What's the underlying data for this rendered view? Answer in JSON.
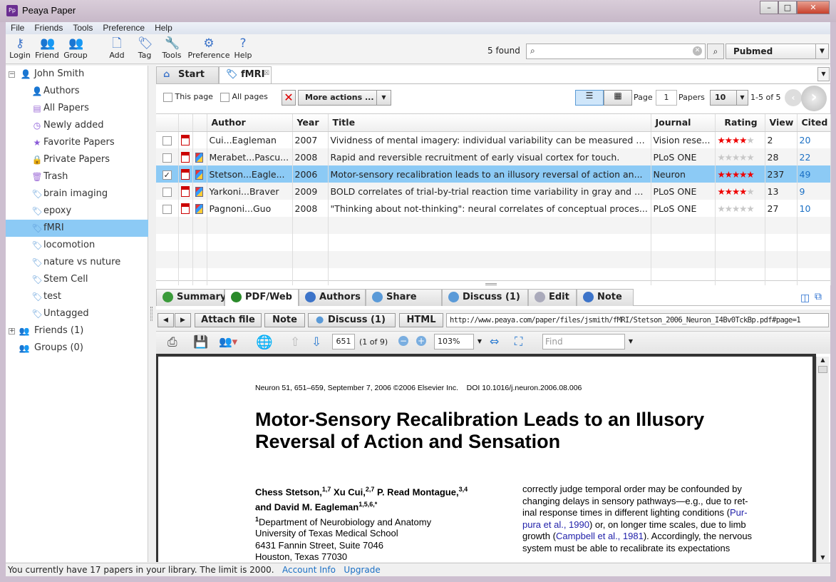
{
  "window": {
    "title": "Peaya Paper",
    "app_icon": "Pp",
    "minimize": "–",
    "maximize": "□",
    "close": "✕"
  },
  "menu": [
    "File",
    "Friends",
    "Tools",
    "Preference",
    "Help"
  ],
  "toolbar": [
    {
      "label": "Login",
      "icon": "key-icon"
    },
    {
      "label": "Friend",
      "icon": "friends-icon"
    },
    {
      "label": "Group",
      "icon": "group-icon"
    },
    {
      "label": "Add",
      "icon": "add-document-icon"
    },
    {
      "label": "Tag",
      "icon": "tag-icon"
    },
    {
      "label": "Tools",
      "icon": "wrench-icon"
    },
    {
      "label": "Preference",
      "icon": "gear-icon"
    },
    {
      "label": "Help",
      "icon": "help-icon"
    }
  ],
  "search": {
    "found": "5 found",
    "value": "",
    "database": "Pubmed"
  },
  "sidebar": {
    "user": "John Smith",
    "items": [
      "Authors",
      "All Papers",
      "Newly added",
      "Favorite Papers",
      "Private Papers",
      "Trash",
      "brain imaging",
      "epoxy",
      "fMRI",
      "locomotion",
      "nature vs nuture",
      "Stem Cell",
      "test",
      "Untagged"
    ],
    "selected": "fMRI",
    "friends": "Friends (1)",
    "groups": "Groups (0)"
  },
  "tabs": [
    "Start",
    "fMRI"
  ],
  "actions": {
    "this_page": "This page",
    "all_pages": "All pages",
    "more_actions": "More actions ...",
    "page_label": "Page",
    "page": "1",
    "papers_label": "Papers",
    "papers_per_page": "10",
    "range": "1-5 of 5"
  },
  "table": {
    "columns": [
      "Author",
      "Year",
      "Title",
      "Journal",
      "Rating",
      "View",
      "Cited"
    ],
    "rows": [
      {
        "checked": false,
        "has_doc": false,
        "author": "Cui...Eagleman",
        "year": "2007",
        "title": "Vividness of mental imagery: individual variability can be measured o...",
        "journal": "Vision rese...",
        "rating": 4,
        "view": "2",
        "cited": "20"
      },
      {
        "checked": false,
        "has_doc": true,
        "author": "Merabet...Pascu...",
        "year": "2008",
        "title": "Rapid and reversible recruitment of early visual cortex for touch.",
        "journal": "PLoS ONE",
        "rating": 0,
        "view": "28",
        "cited": "22"
      },
      {
        "checked": true,
        "has_doc": true,
        "author": "Stetson...Eagle...",
        "year": "2006",
        "title": "Motor-sensory recalibration leads to an illusory reversal of action an...",
        "journal": "Neuron",
        "rating": 5,
        "view": "237",
        "cited": "49"
      },
      {
        "checked": false,
        "has_doc": true,
        "author": "Yarkoni...Braver",
        "year": "2009",
        "title": "BOLD correlates of trial-by-trial reaction time variability in gray and w...",
        "journal": "PLoS ONE",
        "rating": 4,
        "view": "13",
        "cited": "9"
      },
      {
        "checked": false,
        "has_doc": true,
        "author": "Pagnoni...Guo",
        "year": "2008",
        "title": "\"Thinking about not-thinking\": neural correlates of conceptual proces...",
        "journal": "PLoS ONE",
        "rating": 0,
        "view": "27",
        "cited": "10"
      }
    ]
  },
  "detail_tabs": [
    "Summary",
    "PDF/Web",
    "Authors",
    "Share",
    "Discuss (1)",
    "Edit",
    "Note"
  ],
  "detail_active": "PDF/Web",
  "pdfbar": {
    "attach": "Attach file",
    "note": "Note",
    "discuss": "Discuss (1)",
    "html": "HTML",
    "url": "http://www.peaya.com/paper/files/jsmith/fMRI/Stetson_2006_Neuron_I4Bv0TckBp.pdf#page=1"
  },
  "viewer": {
    "page": "651",
    "of": "(1 of 9)",
    "zoom": "103%",
    "find_placeholder": "Find"
  },
  "paper": {
    "header": "Neuron 51, 651–659, September 7, 2006 ©2006 Elsevier Inc.    DOI 10.1016/j.neuron.2006.08.006",
    "title1": "Motor-Sensory Recalibration Leads to an Illusory",
    "title2": "Reversal of Action and Sensation",
    "a1": "Chess Stetson,",
    "s1": "1,7",
    "a2": " Xu Cui,",
    "s2": "2,7",
    "a3": " P. Read Montague,",
    "s3": "3,4",
    "a4": "and David M. Eagleman",
    "s4": "1,5,6,*",
    "aff_sup": "1",
    "aff1": "Department of Neurobiology and Anatomy",
    "aff2": "University of Texas Medical School",
    "aff3": "6431 Fannin Street, Suite 7046",
    "aff4": "Houston, Texas 77030",
    "r1": "correctly judge temporal order may be confounded by",
    "r2": "changing delays in sensory pathways—e.g., due to ret-",
    "r3a": "inal response times in different lighting conditions (",
    "r3b": "Pur-",
    "r4a": "pura et al., 1990",
    "r4b": ") or, on longer time scales, due to limb",
    "r5a": "growth (",
    "r5b": "Campbell et al., 1981",
    "r5c": "). Accordingly, the nervous",
    "r6": "system must be able to recalibrate its expectations"
  },
  "status": {
    "text": "You currently have 17 papers in your library. The limit is 2000.",
    "account": "Account Info",
    "upgrade": "Upgrade"
  }
}
